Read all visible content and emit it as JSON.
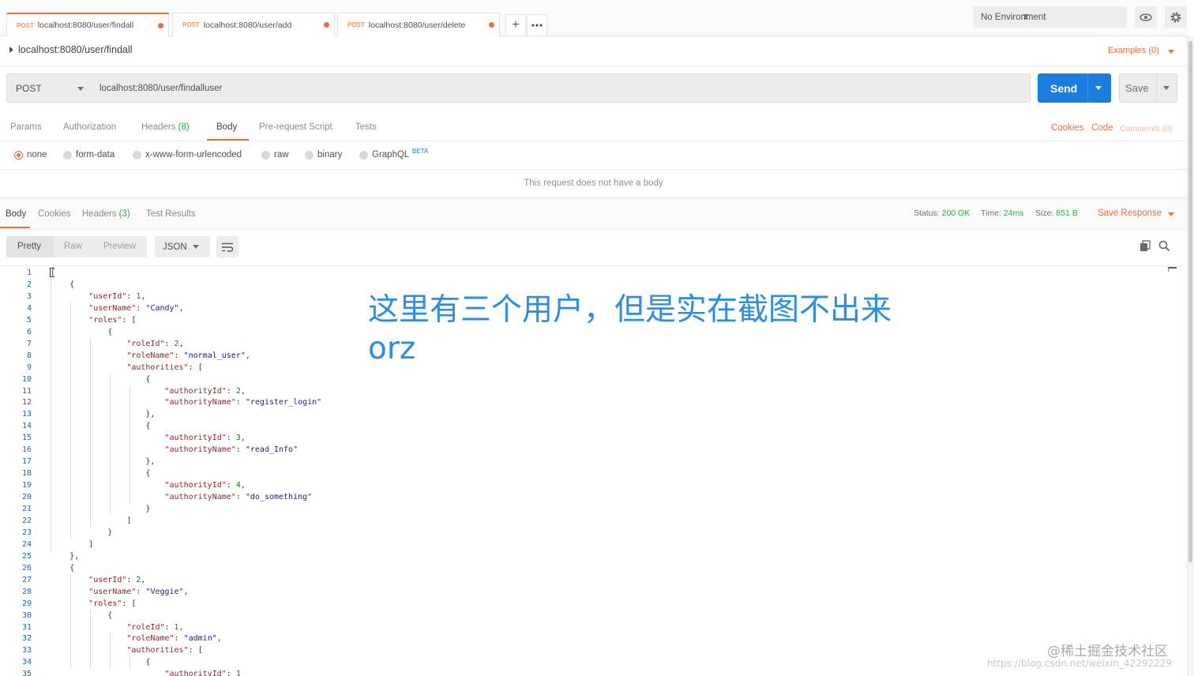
{
  "tabs": [
    {
      "method": "POST",
      "url": "localhost:8080/user/findall"
    },
    {
      "method": "POST",
      "url": "localhost:8080/user/add"
    },
    {
      "method": "POST",
      "url": "localhost:8080/user/delete"
    }
  ],
  "environment": "No Environment",
  "request_title": "localhost:8080/user/findall",
  "examples_label": "Examples (0)",
  "method": "POST",
  "url": "localhost:8080/user/findalluser",
  "send_label": "Send",
  "save_label": "Save",
  "request_tabs": {
    "params": "Params",
    "authorization": "Authorization",
    "headers": "Headers",
    "headers_count": "(8)",
    "body": "Body",
    "prerequest": "Pre-request Script",
    "tests": "Tests"
  },
  "right_links": {
    "cookies": "Cookies",
    "code": "Code",
    "comments": "Comments (0)"
  },
  "body_types": [
    "none",
    "form-data",
    "x-www-form-urlencoded",
    "raw",
    "binary",
    "GraphQL"
  ],
  "beta_badge": "BETA",
  "no_body_text": "This request does not have a body",
  "response_tabs": {
    "body": "Body",
    "cookies": "Cookies",
    "headers": "Headers",
    "headers_count": "(3)",
    "test_results": "Test Results"
  },
  "response_meta": {
    "status_label": "Status:",
    "status": "200 OK",
    "time_label": "Time:",
    "time": "24ms",
    "size_label": "Size:",
    "size": "851 B"
  },
  "save_response_label": "Save Response",
  "view_modes": [
    "Pretty",
    "Raw",
    "Preview"
  ],
  "format": "JSON",
  "code_lines": [
    "[",
    "    {",
    "        \"userId\": 1,",
    "        \"userName\": \"Candy\",",
    "        \"roles\": [",
    "            {",
    "                \"roleId\": 2,",
    "                \"roleName\": \"normal_user\",",
    "                \"authorities\": [",
    "                    {",
    "                        \"authorityId\": 2,",
    "                        \"authorityName\": \"register_login\"",
    "                    },",
    "                    {",
    "                        \"authorityId\": 3,",
    "                        \"authorityName\": \"read_Info\"",
    "                    },",
    "                    {",
    "                        \"authorityId\": 4,",
    "                        \"authorityName\": \"do_something\"",
    "                    }",
    "                ]",
    "            }",
    "        ]",
    "    },",
    "    {",
    "        \"userId\": 2,",
    "        \"userName\": \"Veggie\",",
    "        \"roles\": [",
    "            {",
    "                \"roleId\": 1,",
    "                \"roleName\": \"admin\",",
    "                \"authorities\": [",
    "                    {",
    "                        \"authorityId\": 1"
  ],
  "overlay_note": "这里有三个用户，但是实在截图不出来orz",
  "watermark": "@稀土掘金技术社区",
  "watermark_url": "https://blog.csdn.net/weixin_42292229",
  "colors": {
    "accent": "#f26b3a",
    "send": "#1a7ee0",
    "ok": "#2ba84a",
    "note": "#2a8de8"
  },
  "icons": [
    "plus-icon",
    "more-icon",
    "eye-icon",
    "gear-icon",
    "wrap-icon",
    "copy-icon",
    "search-icon"
  ]
}
